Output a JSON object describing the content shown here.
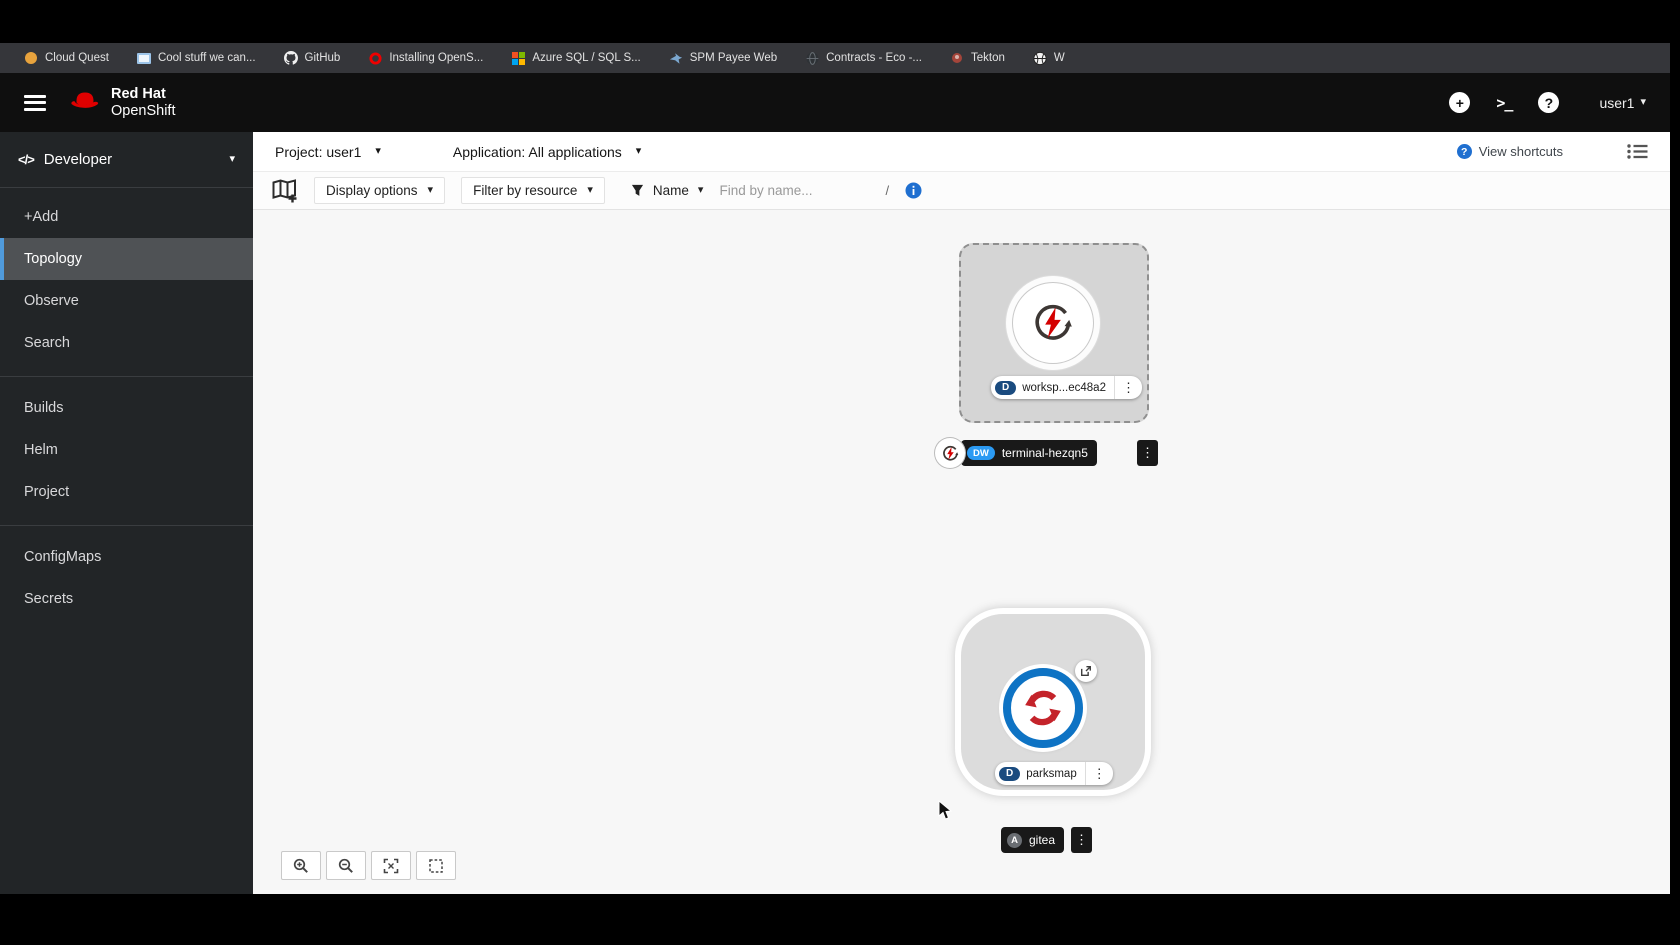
{
  "browser": {
    "bookmarks": [
      {
        "label": "Cloud Quest"
      },
      {
        "label": "Cool stuff we can..."
      },
      {
        "label": "GitHub"
      },
      {
        "label": "Installing OpenS..."
      },
      {
        "label": "Azure SQL / SQL S..."
      },
      {
        "label": "SPM Payee Web"
      },
      {
        "label": "Contracts - Eco -..."
      },
      {
        "label": "Tekton"
      },
      {
        "label": "W"
      }
    ]
  },
  "masthead": {
    "brand_top": "Red Hat",
    "brand_bottom": "OpenShift",
    "user": "user1"
  },
  "sidebar": {
    "perspective": "Developer",
    "items": [
      {
        "label": "+Add"
      },
      {
        "label": "Topology"
      },
      {
        "label": "Observe"
      },
      {
        "label": "Search"
      },
      {
        "label": "Builds"
      },
      {
        "label": "Helm"
      },
      {
        "label": "Project"
      },
      {
        "label": "ConfigMaps"
      },
      {
        "label": "Secrets"
      }
    ]
  },
  "context_bar": {
    "project": "Project: user1",
    "application": "Application: All applications",
    "view_shortcuts": "View shortcuts"
  },
  "toolbar": {
    "display_options": "Display options",
    "filter_by_resource": "Filter by resource",
    "name_filter": "Name",
    "find_placeholder": "Find by name...",
    "shortcut_hint": "/"
  },
  "topology": {
    "workspace": {
      "badge": "D",
      "label": "worksp...ec48a2"
    },
    "terminal": {
      "badge": "DW",
      "label": "terminal-hezqn5"
    },
    "parksmap": {
      "badge": "D",
      "label": "parksmap"
    },
    "gitea": {
      "badge": "A",
      "label": "gitea"
    }
  },
  "glyphs": {
    "caret": "▾",
    "kebab": "⋮",
    "terminal_prompt": ">_",
    "plus": "+",
    "question": "?",
    "info": "i"
  },
  "colors": {
    "accent_blue": "#2b9af3",
    "badge_deployment": "#1a4b7f",
    "badge_devworkspace": "#2b9af3",
    "badge_app_gray": "#6a6e73",
    "parksmap_ring": "#0e73c4",
    "parksmap_arrows": "#c4232a",
    "bolt_red": "#d40000",
    "nav_selected_bar": "#509bdc"
  }
}
